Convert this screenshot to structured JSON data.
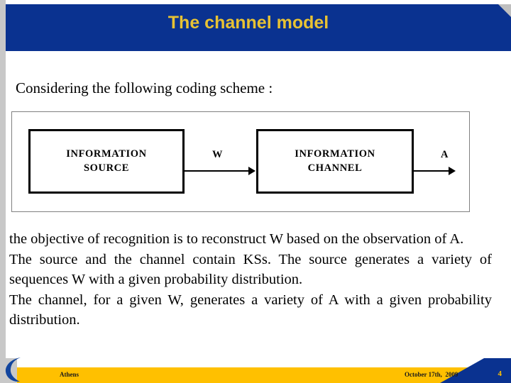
{
  "slide": {
    "title": "The channel model",
    "intro": "Considering the following coding scheme :",
    "body": {
      "para1_line1": "the objective of recognition is to reconstruct W based on the observation of A.",
      "para2": "The source and the channel contain KSs. The source generates a variety of sequences W with a given probability distribution.",
      "para3": "The channel, for a given W, generates a variety of A with a given probability distribution."
    }
  },
  "diagram": {
    "source_box": {
      "line1": "INFORMATION",
      "line2": "SOURCE"
    },
    "channel_box": {
      "line1": "INFORMATION",
      "line2": "CHANNEL"
    },
    "arrow_w_label": "W",
    "arrow_a_label": "A"
  },
  "footer": {
    "location": "Athens",
    "date": "October 17th,  2009",
    "page_number": "4"
  },
  "colors": {
    "banner_blue": "#0a3290",
    "title_gold": "#e8c233",
    "footer_yellow": "#ffc000",
    "rail_gray": "#c8c8c8"
  }
}
